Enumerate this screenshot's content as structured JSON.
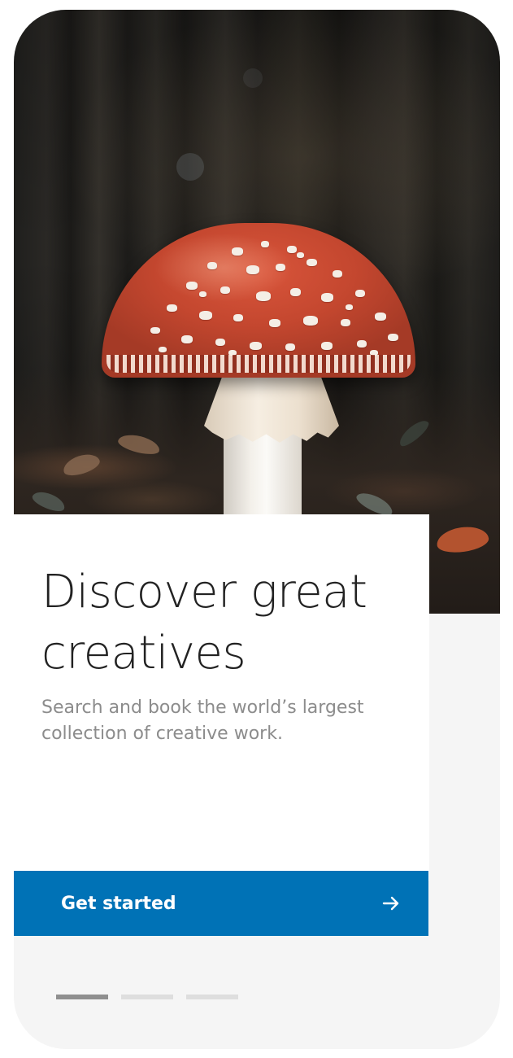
{
  "onboarding": {
    "hero_image": "toadstool-mushroom-forest-photo",
    "title": "Discover great creatives",
    "subtitle": "Search and book the world’s largest collection of creative work.",
    "cta": {
      "label": "Get started",
      "icon": "arrow-right-icon"
    },
    "pager": {
      "current": 1,
      "total": 3
    }
  },
  "colors": {
    "primary": "#0072b6",
    "title_text": "#222222",
    "subtitle_text": "#8c8c8c",
    "pager_active": "#8f8f8f",
    "pager_inactive": "#dedede",
    "background": "#f5f5f5"
  }
}
